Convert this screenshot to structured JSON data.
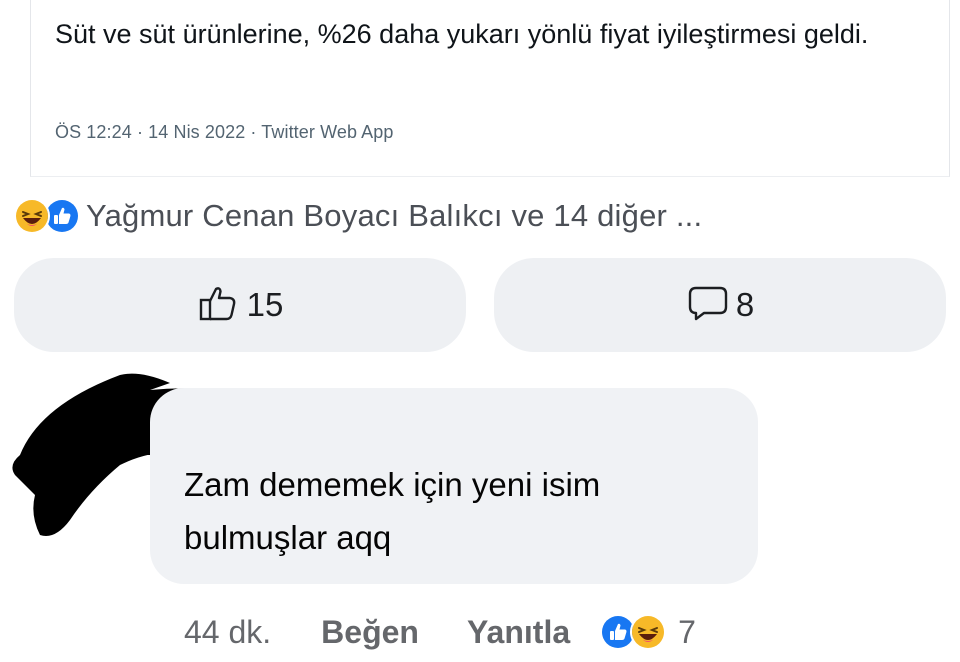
{
  "tweet": {
    "text": "Süt ve süt ürünlerine, %26 daha yukarı yönlü fiyat iyileştirmesi geldi.",
    "meta": "ÖS 12:24 · 14 Nis 2022 · Twitter Web App"
  },
  "reactions": {
    "icons": [
      "haha-emoji-icon",
      "like-reaction-icon"
    ],
    "summary": "Yağmur Cenan Boyacı Balıkcı ve 14 diğer ..."
  },
  "actions": {
    "like_count": "15",
    "comment_count": "8"
  },
  "comment": {
    "text": "Zam dememek için yeni isim bulmuşlar aqq",
    "time": "44 dk.",
    "like_label": "Beğen",
    "reply_label": "Yanıtla",
    "reaction_icons": [
      "like-reaction-icon",
      "haha-emoji-icon"
    ],
    "reaction_count": "7"
  },
  "colors": {
    "pill_background": "#eef0f3",
    "bubble_background": "#f0f2f5",
    "like_blue": "#1877f2",
    "haha_yellow": "#f7b928",
    "secondary_text": "#65676b"
  }
}
